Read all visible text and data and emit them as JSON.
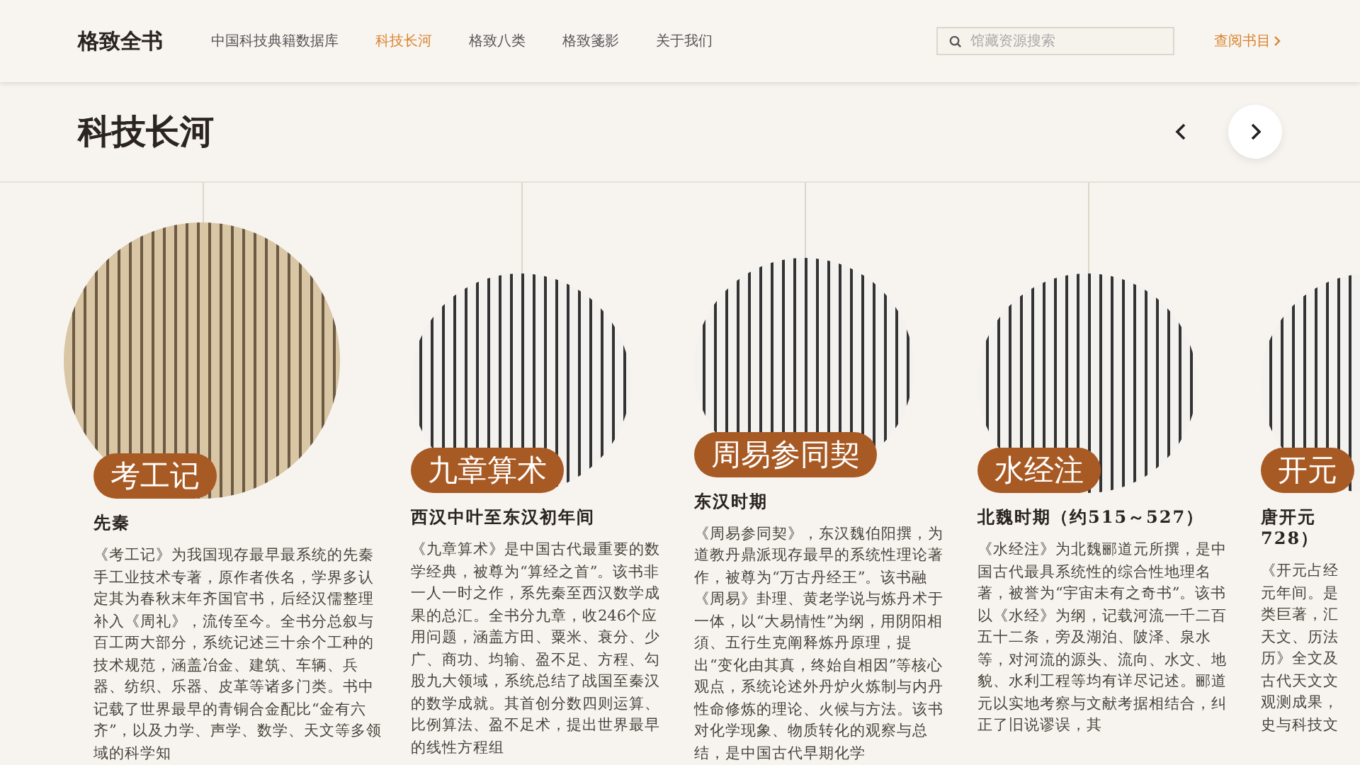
{
  "header": {
    "logo": "格致全书",
    "nav": [
      {
        "label": "中国科技典籍数据库",
        "selected": false
      },
      {
        "label": "科技长河",
        "selected": true
      },
      {
        "label": "格致八类",
        "selected": false
      },
      {
        "label": "格致箋影",
        "selected": false
      },
      {
        "label": "关于我们",
        "selected": false
      }
    ],
    "search": {
      "placeholder": "馆藏资源搜索"
    },
    "catalog_link": "查阅书目"
  },
  "page_title": "科技长河",
  "cards": [
    {
      "selected": true,
      "label": "考工记",
      "period": "先秦",
      "description": "《考工记》为我国现存最早最系统的先秦手工业技术专著，原作者佚名，学界多认定其为春秋末年齐国官书，后经汉儒整理补入《周礼》，流传至今。全书分总叙与百工两大部分，系统记述三十余个工种的技术规范，涵盖冶金、建筑、车辆、兵器、纺织、乐器、皮革等诸多门类。书中记载了世界最早的青铜合金配比“金有六齐”，以及力学、声学、数学、天文等多领域的科学知"
    },
    {
      "selected": false,
      "label": "九章算术",
      "period": "西汉中叶至东汉初年间",
      "description": "《九章算术》是中国古代最重要的数学经典，被尊为“算经之首”。该书非一人一时之作，系先秦至西汉数学成果的总汇。全书分九章，收246个应用问题，涵盖方田、粟米、衰分、少广、商功、均输、盈不足、方程、勾股九大领域，系统总结了战国至秦汉的数学成就。其首创分数四则运算、比例算法、盈不足术，提出世界最早的线性方程组"
    },
    {
      "selected": false,
      "label": "周易参同契",
      "period": "东汉时期",
      "description": "《周易参同契》，东汉魏伯阳撰，为道教丹鼎派现存最早的系统性理论著作，被尊为“万古丹经王”。该书融《周易》卦理、黄老学说与炼丹术于一体，以“大易情性”为纲，用阴阳相須、五行生克阐释炼丹原理，提出“变化由其真，终始自相因”等核心观点，系统论述外丹炉火炼制与内丹性命修炼的理论、火候与方法。该书对化学现象、物质转化的观察与总结，是中国古代早期化学"
    },
    {
      "selected": false,
      "label": "水经注",
      "period": "北魏时期（约515～527）",
      "description": "《水经注》为北魏郦道元所撰，是中国古代最具系统性的综合性地理名著，被誉为“宇宙未有之奇书”。该书以《水经》为纲，记载河流一千二百五十二条，旁及湖泊、陂泽、泉水等，对河流的源头、流向、水文、地貌、水利工程等均有详尽记述。郦道元以实地考察与文献考据相结合，纠正了旧说谬误，其"
    },
    {
      "selected": false,
      "label": "开元",
      "period_lines": [
        "唐开元",
        "728）"
      ],
      "lines": [
        "《开元占经",
        "元年间。是",
        "类巨著，汇",
        "天文、历法",
        "历》全文及",
        "古代天文文",
        "观测成果，",
        "史与科技文"
      ]
    }
  ]
}
